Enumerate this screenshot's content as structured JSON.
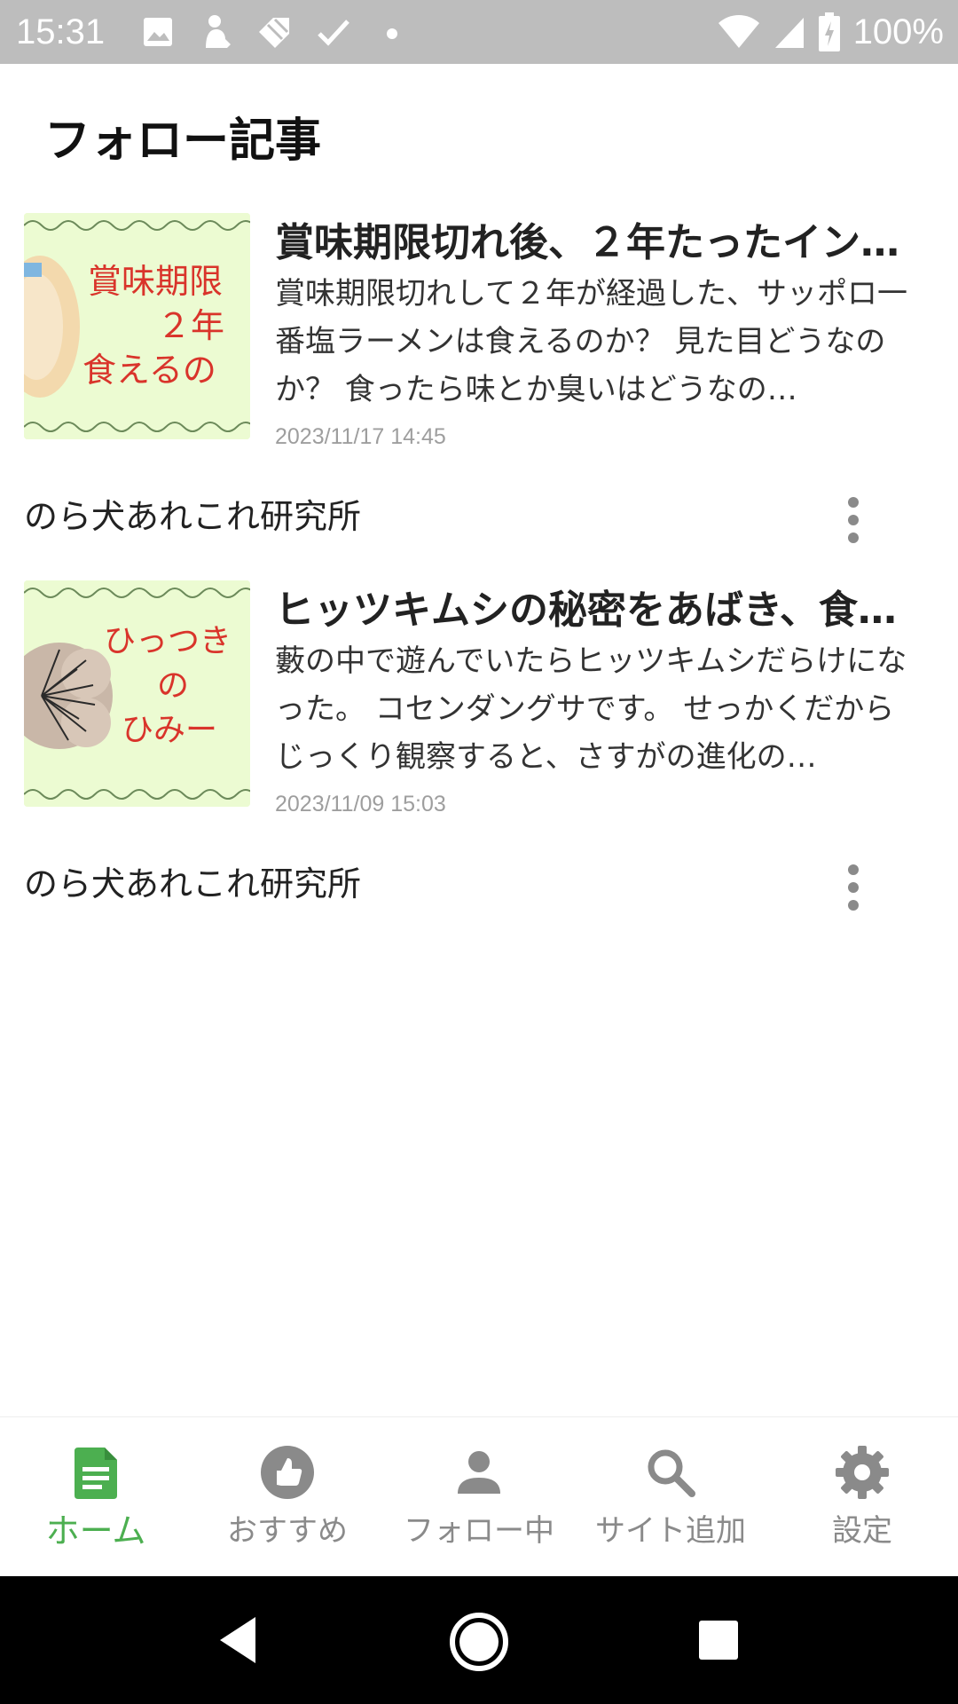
{
  "status_bar": {
    "time": "15:31",
    "battery": "100%",
    "notification_icons": [
      "image-icon",
      "person-icon",
      "tag-icon",
      "check-icon",
      "dot-icon"
    ],
    "system_icons": [
      "wifi-icon",
      "signal-icon",
      "battery-charging-icon"
    ]
  },
  "header": {
    "title": "フォロー記事"
  },
  "articles": [
    {
      "title": "賞味期限切れ後、２年たったイン…",
      "description": "賞味期限切れして２年が経過した、サッポロ一番塩ラーメンは食えるのか？ 見た目どうなのか？ 食ったら味とか臭いはどうなの…",
      "date": "2023/11/17 14:45",
      "source": "のら犬あれこれ研究所",
      "thumbnail_text": [
        "賞味期限",
        "２年",
        "食えるの"
      ]
    },
    {
      "title": "ヒッツキムシの秘密をあばき、食…",
      "description": "藪の中で遊んでいたらヒッツキムシだらけになった。 コセンダングサです。 せっかくだからじっくり観察すると、さすがの進化の…",
      "date": "2023/11/09 15:03",
      "source": "のら犬あれこれ研究所",
      "thumbnail_text": [
        "ひっつき",
        "の",
        "ひみー"
      ]
    }
  ],
  "bottom_nav": {
    "items": [
      {
        "label": "ホーム",
        "icon": "document-icon",
        "active": true
      },
      {
        "label": "おすすめ",
        "icon": "thumbs-up-icon",
        "active": false
      },
      {
        "label": "フォロー中",
        "icon": "person-icon",
        "active": false
      },
      {
        "label": "サイト追加",
        "icon": "search-icon",
        "active": false
      },
      {
        "label": "設定",
        "icon": "gear-icon",
        "active": false
      }
    ]
  },
  "colors": {
    "accent": "#4caf50",
    "inactive": "#8a8a8a",
    "status_bar": "#bdbdbd"
  }
}
